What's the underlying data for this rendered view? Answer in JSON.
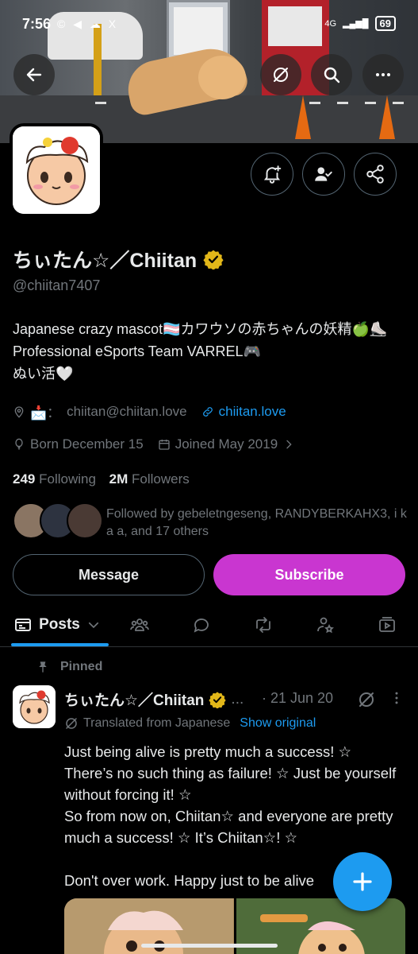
{
  "status_bar": {
    "time": "7:56",
    "notification_icons": "© ◀ ☁ X",
    "network": "4G",
    "battery": "69"
  },
  "profile": {
    "display_name": "ちぃたん☆／Chiitan",
    "handle": "@chiitan7407",
    "bio_lines": [
      "Japanese crazy mascot🏳️‍⚧️カワウソの赤ちゃんの妖精🍏⛸️",
      "Professional eSports Team VARREL🎮",
      "ぬい活🤍"
    ],
    "location_prefix": "📩：",
    "email": "chiitan@chiitan.love",
    "website": "chiitan.love",
    "born": "Born December 15",
    "joined": "Joined May 2019",
    "following_count": "249",
    "following_label": "Following",
    "followers_count": "2M",
    "followers_label": "Followers",
    "followed_by": "Followed by gebeletngeseng, RANDYBERKAHX3, i k a a, and 17 others"
  },
  "buttons": {
    "message": "Message",
    "subscribe": "Subscribe"
  },
  "tabs": {
    "posts_label": "Posts"
  },
  "post": {
    "pinned_label": "Pinned",
    "author": "ちぃたん☆／Chiitan",
    "ellipsis": "...",
    "date": "· 21 Jun 20",
    "translated_label": "Translated from Japanese",
    "show_original": "Show original",
    "text": "Just being alive is pretty much a success! ☆\nThere’s no such thing as failure! ☆ Just be yourself without forcing it! ☆\nSo from now on, Chiitan☆ and everyone are pretty much a success! ☆ It’s Chiitan☆! ☆\n\nDon't over work. Happy just to be alive"
  },
  "colors": {
    "accent": "#1d9bf0",
    "subscribe": "#c936d0",
    "verified": "#e2b719",
    "muted": "#71767b"
  }
}
